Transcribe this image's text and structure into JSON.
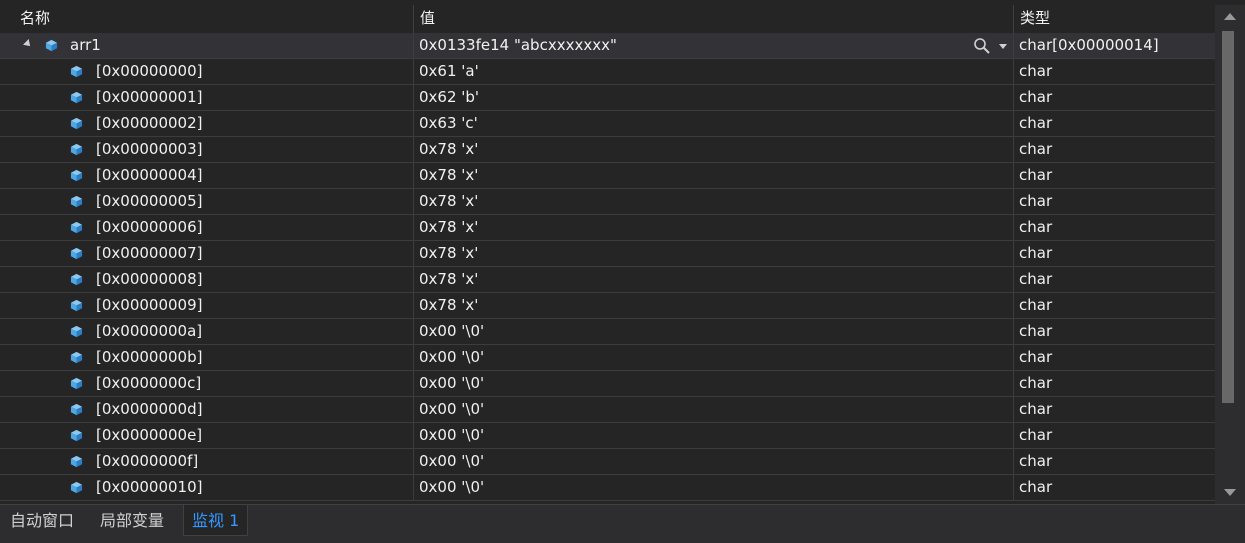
{
  "header": {
    "name": "名称",
    "value": "值",
    "type": "类型"
  },
  "root": {
    "name": "arr1",
    "value": "0x0133fe14 \"abcxxxxxxx\"",
    "type": "char[0x00000014]"
  },
  "children": [
    {
      "name": "[0x00000000]",
      "value": "0x61 'a'",
      "type": "char"
    },
    {
      "name": "[0x00000001]",
      "value": "0x62 'b'",
      "type": "char"
    },
    {
      "name": "[0x00000002]",
      "value": "0x63 'c'",
      "type": "char"
    },
    {
      "name": "[0x00000003]",
      "value": "0x78 'x'",
      "type": "char"
    },
    {
      "name": "[0x00000004]",
      "value": "0x78 'x'",
      "type": "char"
    },
    {
      "name": "[0x00000005]",
      "value": "0x78 'x'",
      "type": "char"
    },
    {
      "name": "[0x00000006]",
      "value": "0x78 'x'",
      "type": "char"
    },
    {
      "name": "[0x00000007]",
      "value": "0x78 'x'",
      "type": "char"
    },
    {
      "name": "[0x00000008]",
      "value": "0x78 'x'",
      "type": "char"
    },
    {
      "name": "[0x00000009]",
      "value": "0x78 'x'",
      "type": "char"
    },
    {
      "name": "[0x0000000a]",
      "value": "0x00 '\\0'",
      "type": "char"
    },
    {
      "name": "[0x0000000b]",
      "value": "0x00 '\\0'",
      "type": "char"
    },
    {
      "name": "[0x0000000c]",
      "value": "0x00 '\\0'",
      "type": "char"
    },
    {
      "name": "[0x0000000d]",
      "value": "0x00 '\\0'",
      "type": "char"
    },
    {
      "name": "[0x0000000e]",
      "value": "0x00 '\\0'",
      "type": "char"
    },
    {
      "name": "[0x0000000f]",
      "value": "0x00 '\\0'",
      "type": "char"
    },
    {
      "name": "[0x00000010]",
      "value": "0x00 '\\0'",
      "type": "char"
    }
  ],
  "tabs": [
    {
      "label": "自动窗口",
      "active": false
    },
    {
      "label": "局部变量",
      "active": false
    },
    {
      "label": "监视 1",
      "active": true
    }
  ],
  "icons": {
    "variable": "cube-icon",
    "search": "search-icon",
    "expand": "expand-triangle-icon"
  },
  "colors": {
    "background": "#252526",
    "accent": "#3399ff",
    "cube": "#4fa8e6"
  }
}
